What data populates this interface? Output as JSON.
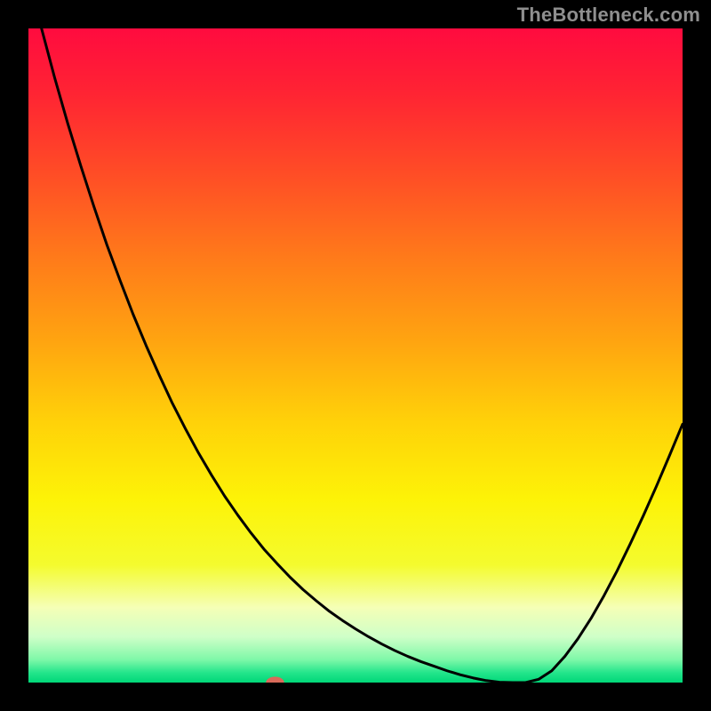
{
  "watermark": "TheBottleneck.com",
  "chart_data": {
    "type": "line",
    "title": "",
    "xlabel": "",
    "ylabel": "",
    "xlim": [
      0,
      100
    ],
    "ylim": [
      0,
      100
    ],
    "x": [
      0,
      2,
      4,
      6,
      8,
      10,
      12,
      14,
      16,
      18,
      20,
      22,
      24,
      26,
      28,
      30,
      32,
      34,
      36,
      38,
      40,
      42,
      44,
      46,
      48,
      50,
      52,
      54,
      56,
      58,
      60,
      62,
      64,
      66,
      68,
      70,
      72,
      74,
      76,
      78,
      80,
      82,
      84,
      86,
      88,
      90,
      92,
      94,
      96,
      98,
      100
    ],
    "values": [
      120,
      100,
      92.5,
      85.5,
      79,
      72.8,
      66.9,
      61.5,
      56.3,
      51.5,
      47,
      42.7,
      38.8,
      35.1,
      31.7,
      28.5,
      25.6,
      22.9,
      20.4,
      18.2,
      16.1,
      14.2,
      12.5,
      10.9,
      9.5,
      8.2,
      7,
      5.9,
      4.9,
      4,
      3.2,
      2.5,
      1.8,
      1.2,
      0.7,
      0.3,
      0.05,
      0,
      0,
      0.5,
      1.8,
      4,
      6.7,
      9.8,
      13.3,
      17.1,
      21.2,
      25.5,
      30,
      34.7,
      39.5
    ],
    "marker": {
      "x": 37.7,
      "y": 0,
      "color": "#d86a5a",
      "rx": 1.4,
      "ry": 0.9
    },
    "gradient_stops": [
      {
        "offset": 0.0,
        "color": "#ff0b3f"
      },
      {
        "offset": 0.1,
        "color": "#ff2433"
      },
      {
        "offset": 0.22,
        "color": "#ff4c26"
      },
      {
        "offset": 0.35,
        "color": "#ff7a1a"
      },
      {
        "offset": 0.48,
        "color": "#ffa510"
      },
      {
        "offset": 0.6,
        "color": "#ffd109"
      },
      {
        "offset": 0.72,
        "color": "#fdf307"
      },
      {
        "offset": 0.82,
        "color": "#f4fb2e"
      },
      {
        "offset": 0.885,
        "color": "#f5ffb6"
      },
      {
        "offset": 0.93,
        "color": "#cfffc8"
      },
      {
        "offset": 0.965,
        "color": "#7ef8a8"
      },
      {
        "offset": 0.985,
        "color": "#23e58b"
      },
      {
        "offset": 1.0,
        "color": "#00d778"
      }
    ]
  }
}
